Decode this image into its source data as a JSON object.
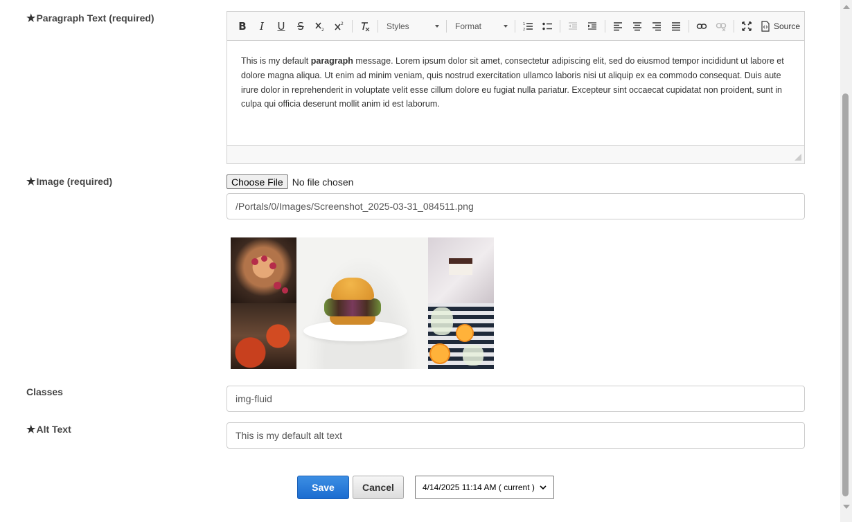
{
  "fields": {
    "paragraph": {
      "label": "Paragraph Text (required)",
      "required": true
    },
    "image": {
      "label": "Image (required)",
      "required": true,
      "choose_label": "Choose File",
      "file_status": "No file chosen",
      "path_value": "/Portals/0/Images/Screenshot_2025-03-31_084511.png"
    },
    "classes": {
      "label": "Classes",
      "value": "img-fluid"
    },
    "alt": {
      "label": "Alt Text",
      "required": true,
      "value": "This is my default alt text"
    }
  },
  "required_marker": "★",
  "editor": {
    "toolbar": {
      "bold": "B",
      "italic": "I",
      "underline": "U",
      "strike": "S",
      "subscript_icon": "subscript-icon",
      "superscript_icon": "superscript-icon",
      "styles_label": "Styles",
      "format_label": "Format",
      "source_label": "Source"
    },
    "content": {
      "before_bold": "This is my default ",
      "bold": "paragraph",
      "after_bold": " message. Lorem ipsum dolor sit amet, consectetur adipiscing elit, sed do eiusmod tempor incididunt ut labore et dolore magna aliqua. Ut enim ad minim veniam, quis nostrud exercitation ullamco laboris nisi ut aliquip ex ea commodo consequat. Duis aute irure dolor in reprehenderit in voluptate velit esse cillum dolore eu fugiat nulla pariatur. Excepteur sint occaecat cupidatat non proident, sunt in culpa qui officia deserunt mollit anim id est laborum."
    }
  },
  "actions": {
    "save_label": "Save",
    "cancel_label": "Cancel",
    "version_selected": "4/14/2025 11:14 AM ( current )"
  },
  "colors": {
    "primary": "#1c6cd0",
    "border": "#cccccc",
    "toolbar_bg": "#f8f8f8"
  }
}
